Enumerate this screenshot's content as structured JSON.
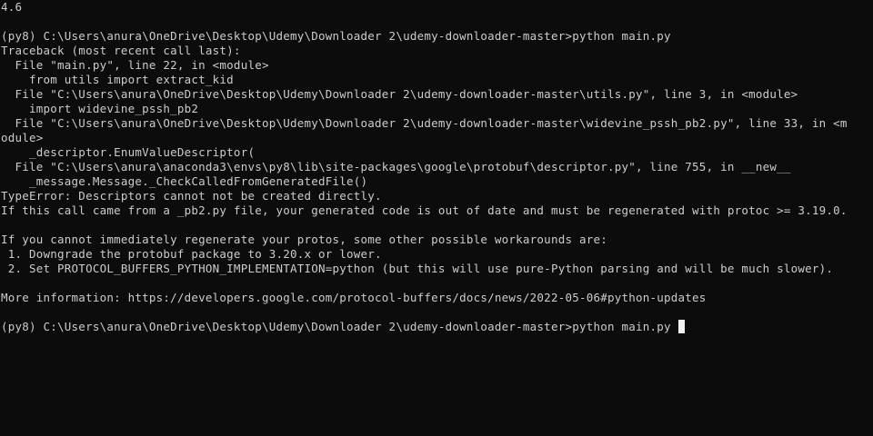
{
  "terminal": {
    "colors": {
      "background": "#0c0c0c",
      "text": "#cccccc",
      "cursor": "#f2f2f2"
    },
    "lines": [
      "4.6",
      "",
      "(py8) C:\\Users\\anura\\OneDrive\\Desktop\\Udemy\\Downloader 2\\udemy-downloader-master>python main.py",
      "Traceback (most recent call last):",
      "  File \"main.py\", line 22, in <module>",
      "    from utils import extract_kid",
      "  File \"C:\\Users\\anura\\OneDrive\\Desktop\\Udemy\\Downloader 2\\udemy-downloader-master\\utils.py\", line 3, in <module>",
      "    import widevine_pssh_pb2",
      "  File \"C:\\Users\\anura\\OneDrive\\Desktop\\Udemy\\Downloader 2\\udemy-downloader-master\\widevine_pssh_pb2.py\", line 33, in <m",
      "odule>",
      "    _descriptor.EnumValueDescriptor(",
      "  File \"C:\\Users\\anura\\anaconda3\\envs\\py8\\lib\\site-packages\\google\\protobuf\\descriptor.py\", line 755, in __new__",
      "    _message.Message._CheckCalledFromGeneratedFile()",
      "TypeError: Descriptors cannot not be created directly.",
      "If this call came from a _pb2.py file, your generated code is out of date and must be regenerated with protoc >= 3.19.0.",
      "",
      "If you cannot immediately regenerate your protos, some other possible workarounds are:",
      " 1. Downgrade the protobuf package to 3.20.x or lower.",
      " 2. Set PROTOCOL_BUFFERS_PYTHON_IMPLEMENTATION=python (but this will use pure-Python parsing and will be much slower).",
      "",
      "More information: https://developers.google.com/protocol-buffers/docs/news/2022-05-06#python-updates",
      ""
    ],
    "prompt": "(py8) C:\\Users\\anura\\OneDrive\\Desktop\\Udemy\\Downloader 2\\udemy-downloader-master>",
    "command_input": "python main.py "
  }
}
